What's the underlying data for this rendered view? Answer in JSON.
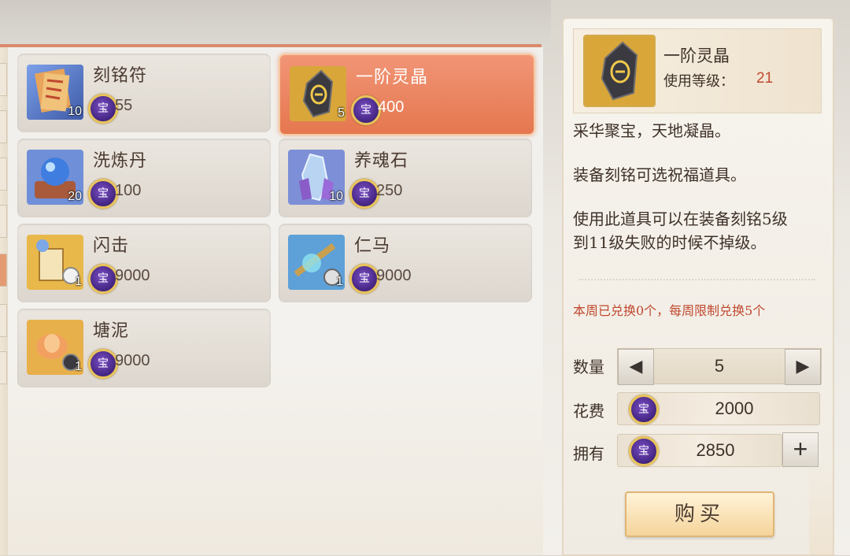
{
  "shop_items": [
    {
      "name": "刻铭符",
      "count": "10",
      "price": "55",
      "icon": "talisman-scroll-icon",
      "selected": false
    },
    {
      "name": "一阶灵晶",
      "count": "5",
      "price": "400",
      "icon": "spirit-crystal-icon",
      "selected": true
    },
    {
      "name": "洗炼丹",
      "count": "20",
      "price": "100",
      "icon": "refine-pill-orb-icon",
      "selected": false
    },
    {
      "name": "养魂石",
      "count": "10",
      "price": "250",
      "icon": "soul-stone-crystal-icon",
      "selected": false
    },
    {
      "name": "闪击",
      "count": "1",
      "price": "9000",
      "icon": "flash-strike-icon",
      "selected": false
    },
    {
      "name": "仁马",
      "count": "1",
      "price": "9000",
      "icon": "ren-ma-icon",
      "selected": false
    },
    {
      "name": "塘泥",
      "count": "1",
      "price": "9000",
      "icon": "pond-mud-lotus-icon",
      "selected": false
    }
  ],
  "currency_glyph": "宝",
  "detail": {
    "name": "一阶灵晶",
    "level_label": "使用等级：",
    "level_value": "21",
    "desc_1": "采华聚宝，天地凝晶。",
    "desc_2": "装备刻铭可选祝福道具。",
    "desc_3_line1": "使用此道具可以在装备刻铭5级",
    "desc_3_line2": "到11级失败的时候不掉级。",
    "limit_text": "本周已兑换0个，每周限制兑换5个",
    "quantity_label": "数量",
    "quantity_value": "5",
    "cost_label": "花费",
    "cost_value": "2000",
    "owned_label": "拥有",
    "owned_value": "2850",
    "buy_label": "购买"
  },
  "colors": {
    "accent": "#e5774f",
    "price_red": "#c0482f",
    "coin_purple": "#4a2a8a",
    "coin_gold": "#e8c35a"
  }
}
